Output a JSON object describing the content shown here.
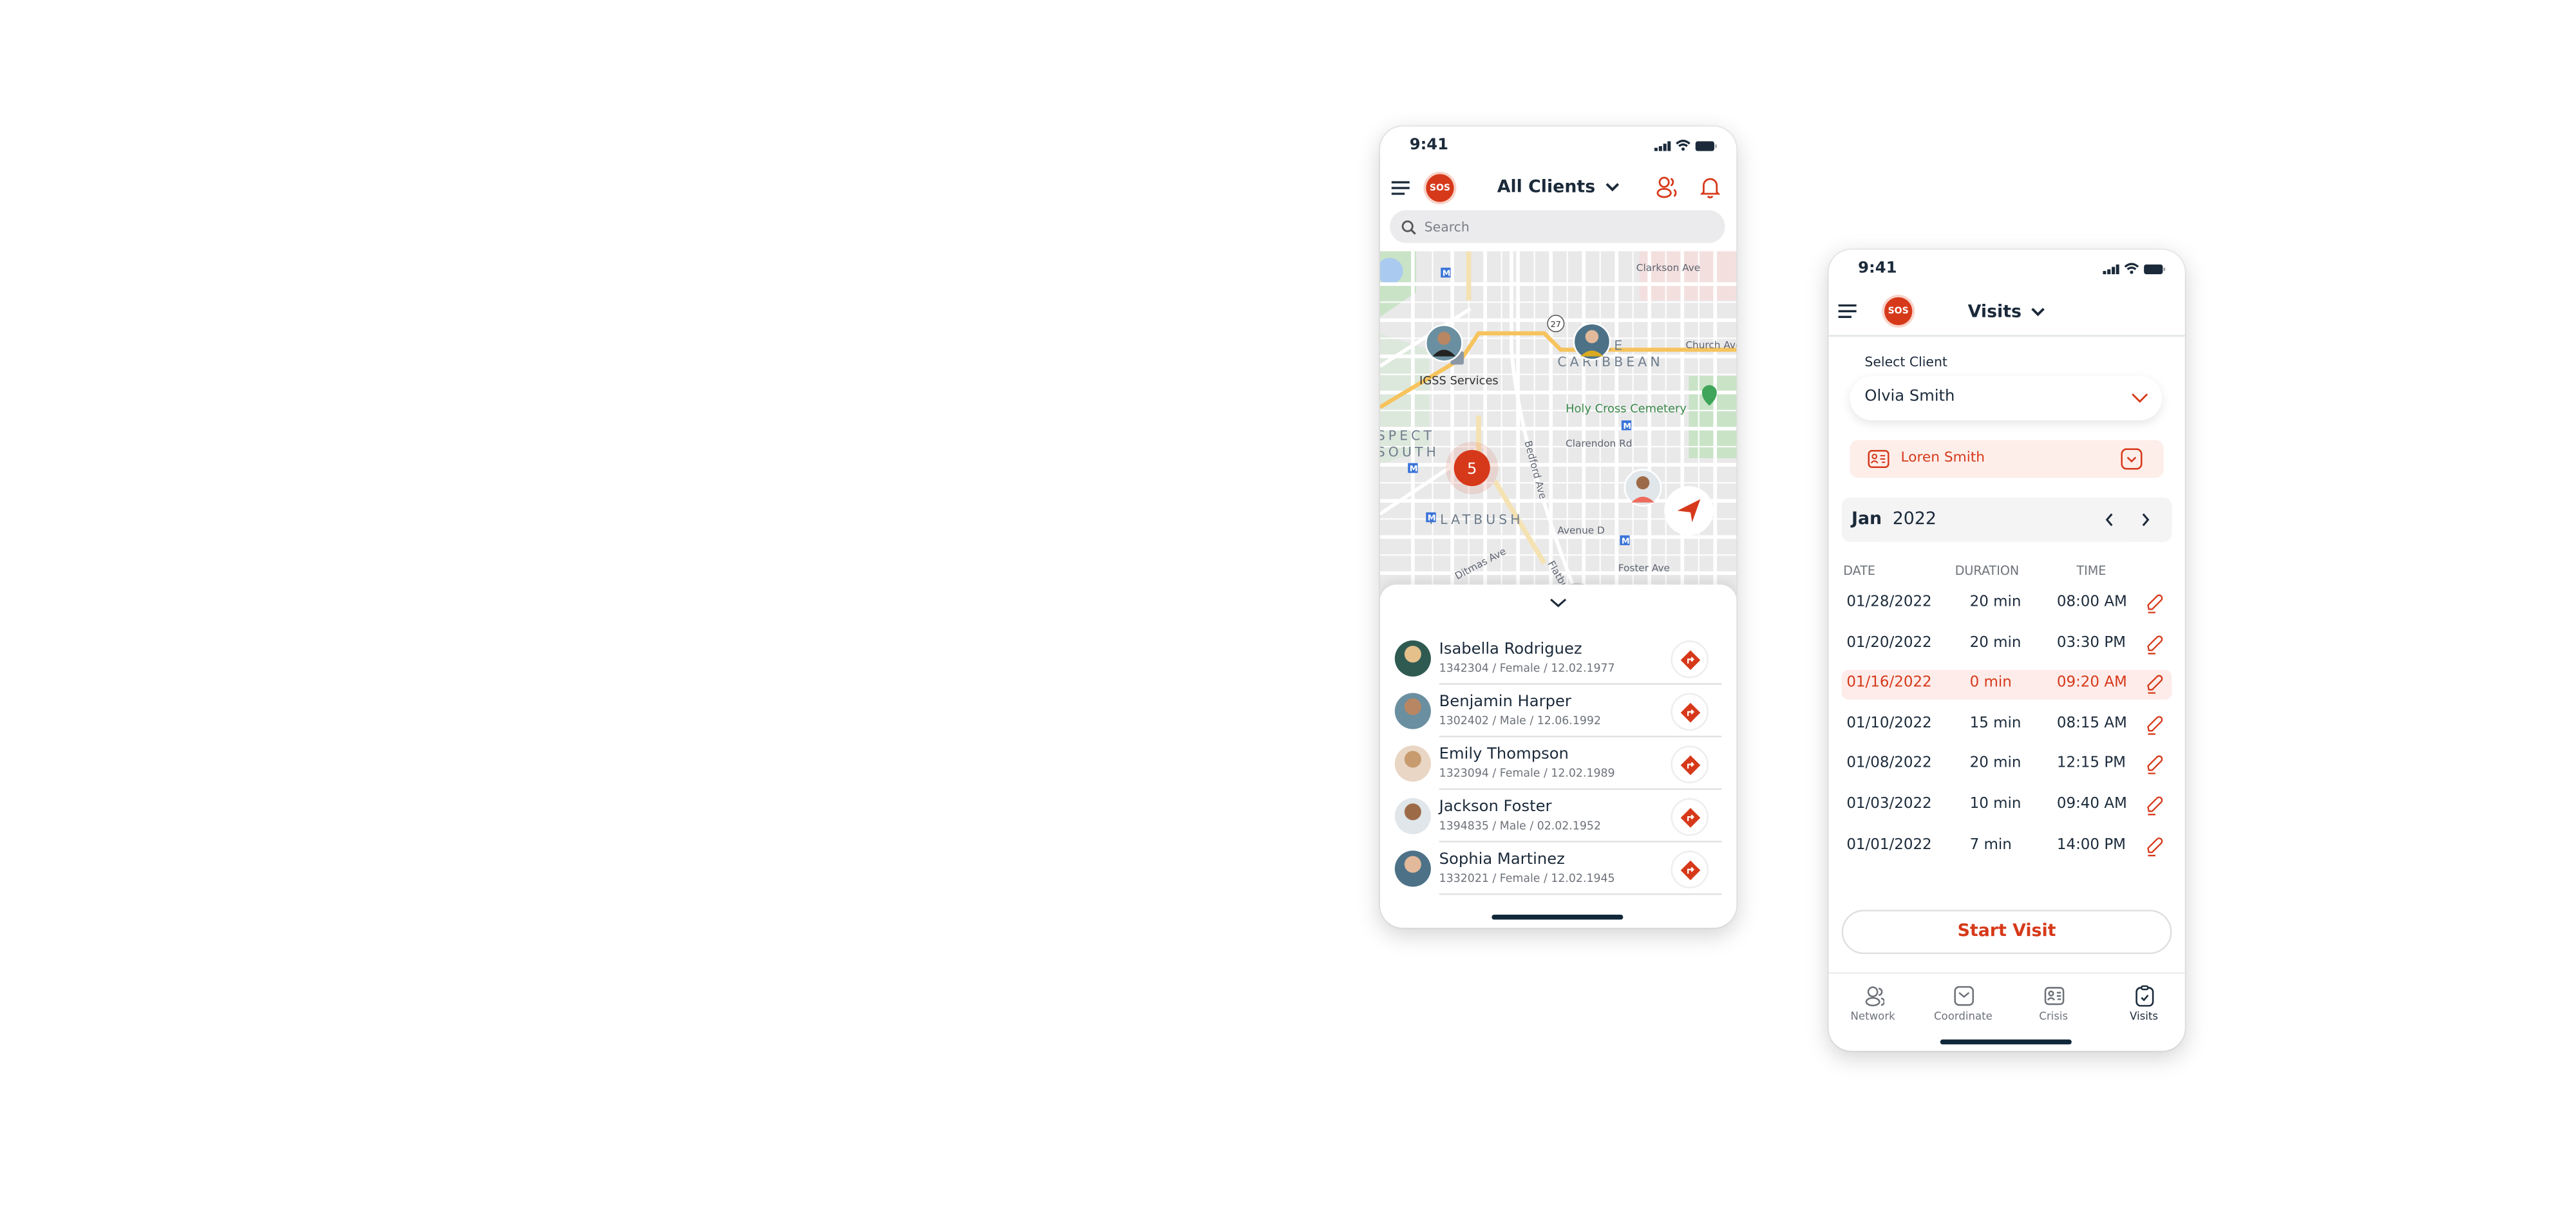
{
  "colors": {
    "accent": "#d6391a",
    "accent_light": "#fdecea",
    "text": "#1b2a3a",
    "muted": "#6e737a"
  },
  "status_bar": {
    "time": "9:41",
    "icons": [
      "cellular-icon",
      "wifi-icon",
      "battery-icon"
    ]
  },
  "map_screen": {
    "header": {
      "menu_icon": "hamburger-icon",
      "sos_label": "SOS",
      "title": "All Clients",
      "title_icon": "chevron-down-icon",
      "actions": [
        "people-icon",
        "bell-icon"
      ]
    },
    "search": {
      "placeholder": "Search",
      "value": ""
    },
    "map": {
      "labels": {
        "street1": "Clarkson Ave",
        "street2": "Church Ave",
        "neighborhood1": "LE",
        "neighborhood2": "CARIBBEAN",
        "poi": "IGSS Services",
        "cemetery": "Holy Cross Cemetery",
        "area1": "SPECT",
        "area2": "SOUTH",
        "bedford": "Bedford Ave",
        "clarendon": "Clarendon Rd",
        "flatbush": "FLATBUSH",
        "avenue_d": "Avenue D",
        "ditmas": "Ditmas Ave",
        "foster": "Foster Ave",
        "flatbush_ave": "Flatbu",
        "route": "27",
        "metro": "M"
      },
      "cluster_count": "5",
      "locate_icon": "navigation-arrow-icon"
    },
    "sheet": {
      "collapse_icon": "chevron-down-icon",
      "clients": [
        {
          "name": "Isabella Rodriguez",
          "meta": "1342304 / Female / 12.02.1977"
        },
        {
          "name": "Benjamin Harper",
          "meta": "1302402 / Male / 12.06.1992"
        },
        {
          "name": "Emily Thompson",
          "meta": "1323094 / Female / 12.02.1989"
        },
        {
          "name": "Jackson Foster",
          "meta": "1394835 / Male / 02.02.1952"
        },
        {
          "name": "Sophia Martinez",
          "meta": "1332021 / Female / 12.02.1945"
        }
      ]
    }
  },
  "visits_screen": {
    "header": {
      "sos_label": "SOS",
      "title": "Visits"
    },
    "select_client": {
      "label": "Select Client",
      "value": "Olvia Smith"
    },
    "contact": {
      "name": "Loren Smith"
    },
    "month": {
      "month": "Jan",
      "year": "2022"
    },
    "table": {
      "headers": [
        "DATE",
        "DURATION",
        "TIME"
      ],
      "rows": [
        {
          "date": "01/28/2022",
          "duration": "20 min",
          "time": "08:00 AM"
        },
        {
          "date": "01/20/2022",
          "duration": "20 min",
          "time": "03:30 PM"
        },
        {
          "date": "01/16/2022",
          "duration": "0 min",
          "time": "09:20 AM",
          "highlighted": true
        },
        {
          "date": "01/10/2022",
          "duration": "15 min",
          "time": "08:15 AM"
        },
        {
          "date": "01/08/2022",
          "duration": "20 min",
          "time": "12:15 PM"
        },
        {
          "date": "01/03/2022",
          "duration": "10 min",
          "time": "09:40 AM"
        },
        {
          "date": "01/01/2022",
          "duration": "7 min",
          "time": "14:00 PM"
        }
      ]
    },
    "start_visit": "Start Visit",
    "bottom_nav": [
      {
        "label": "Network",
        "icon": "people-icon"
      },
      {
        "label": "Coordinate",
        "icon": "inbox-icon"
      },
      {
        "label": "Crisis",
        "icon": "id-card-icon"
      },
      {
        "label": "Visits",
        "icon": "clipboard-check-icon",
        "active": true
      }
    ]
  }
}
